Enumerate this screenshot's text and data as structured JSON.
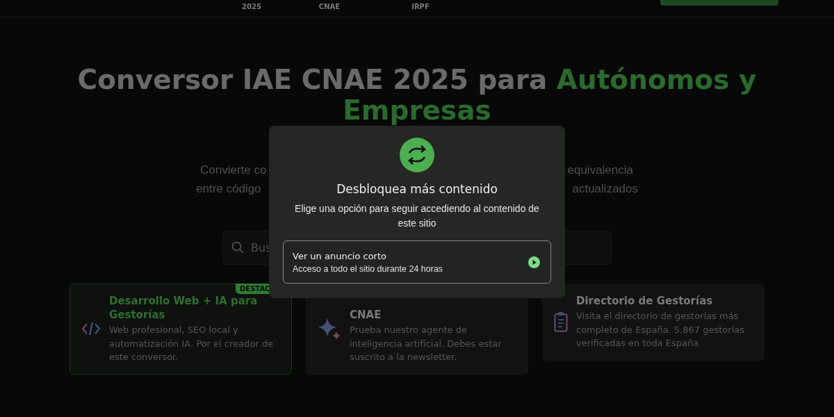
{
  "nav": {
    "items": [
      {
        "label": "2025"
      },
      {
        "label": "CNAE"
      },
      {
        "label": "IRPF"
      }
    ]
  },
  "hero": {
    "title": "Conversor IAE CNAE 2025 para",
    "title_highlight": "Autónomos y Empresas",
    "subtitle_lines": [
      {
        "left": "Convierte co",
        "right": "equivalencia"
      },
      {
        "left": "entre código",
        "right": "actualizados"
      }
    ]
  },
  "search": {
    "placeholder": "Bus"
  },
  "cards": [
    {
      "kind": "code",
      "featured": true,
      "badge": "DESTAC",
      "title": "Desarrollo Web + IA para Gestorías",
      "text": "Web profesional, SEO local y automatización IA. Por el creador de este conversor."
    },
    {
      "kind": "sparkle",
      "featured": false,
      "title": "CNAE",
      "text": "Prueba nuestro agente de inteligencia artificial. Debes estar suscrito a la newsletter."
    },
    {
      "kind": "clipboard",
      "featured": false,
      "title": "Directorio de Gestorías",
      "text": "Visita el directorio de gestorías más completo de España. 5.867 gestorías verificadas en toda España"
    }
  ],
  "modal": {
    "title": "Desbloquea más contenido",
    "text": "Elige una opción para seguir accediendo al contenido de este sitio",
    "options": [
      {
        "title": "Ver un anuncio corto",
        "subtitle": "Acceso a todo el sitio durante 24 horas"
      }
    ]
  }
}
